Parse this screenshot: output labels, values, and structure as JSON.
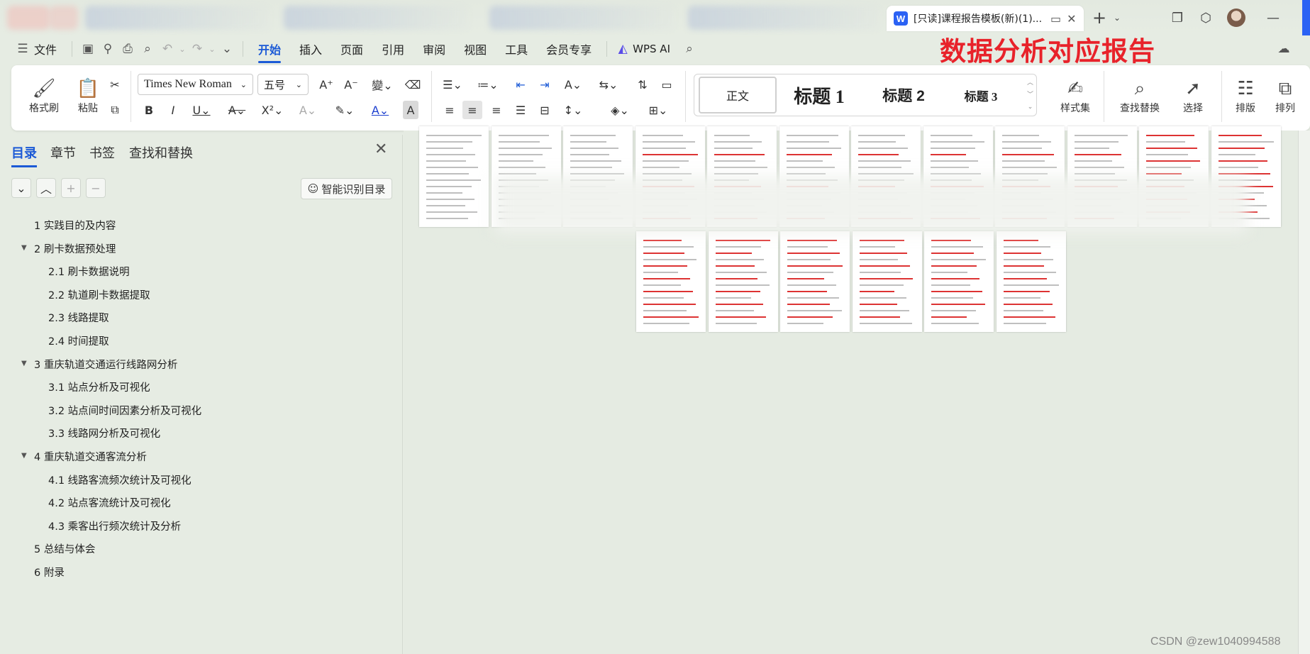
{
  "titlebar": {
    "tab_title": "[只读]课程报告模板(新)(1)...",
    "app_icon_letter": "W",
    "new_tab_symbol": "+",
    "minimize_symbol": "—",
    "icons": [
      "monitor-icon",
      "close-icon",
      "plus-icon",
      "chevron-down-icon",
      "restore-window-icon",
      "cube-icon",
      "avatar",
      "minimize-icon"
    ]
  },
  "menubar": {
    "file_label": "文件",
    "hamburger": "☰",
    "tabs": [
      "开始",
      "插入",
      "页面",
      "引用",
      "审阅",
      "视图",
      "工具",
      "会员专享"
    ],
    "wps_ai_label": "WPS AI"
  },
  "overlay_title": "数据分析对应报告",
  "ribbon": {
    "format_painter": "格式刷",
    "paste": "粘贴",
    "font_name": "Times New Roman",
    "font_size": "五号",
    "styles": {
      "normal": "正文",
      "h1": "标题 1",
      "h2": "标题 2",
      "h3": "标题 3"
    },
    "style_set": "样式集",
    "find_replace": "查找替换",
    "select": "选择",
    "layout": "排版",
    "arrange": "排列"
  },
  "nav": {
    "tabs": [
      "目录",
      "章节",
      "书签",
      "查找和替换"
    ],
    "smart_toc_button": "智能识别目录",
    "toc": [
      {
        "text": "1  实践目的及内容",
        "level": 1,
        "expandable": false
      },
      {
        "text": "2 刷卡数据预处理",
        "level": 1,
        "expandable": true
      },
      {
        "text": "2.1 刷卡数据说明",
        "level": 2,
        "expandable": false
      },
      {
        "text": "2.2  轨道刷卡数据提取",
        "level": 2,
        "expandable": false
      },
      {
        "text": "2.3  线路提取",
        "level": 2,
        "expandable": false
      },
      {
        "text": "2.4 时间提取",
        "level": 2,
        "expandable": false
      },
      {
        "text": "3  重庆轨道交通运行线路网分析",
        "level": 1,
        "expandable": true
      },
      {
        "text": "3.1 站点分析及可视化",
        "level": 2,
        "expandable": false
      },
      {
        "text": "3.2 站点间时间因素分析及可视化",
        "level": 2,
        "expandable": false
      },
      {
        "text": "3.3 线路网分析及可视化",
        "level": 2,
        "expandable": false
      },
      {
        "text": "4  重庆轨道交通客流分析",
        "level": 1,
        "expandable": true
      },
      {
        "text": "4.1  线路客流频次统计及可视化",
        "level": 2,
        "expandable": false
      },
      {
        "text": "4.2 站点客流统计及可视化",
        "level": 2,
        "expandable": false
      },
      {
        "text": "4.3 乘客出行频次统计及分析",
        "level": 2,
        "expandable": false
      },
      {
        "text": "5  总结与体会",
        "level": 1,
        "expandable": false
      },
      {
        "text": "6 附录",
        "level": 1,
        "expandable": false
      }
    ]
  },
  "document": {
    "row1_page_count": 12,
    "row2_page_count": 6
  },
  "watermark": "CSDN @zew1040994588"
}
